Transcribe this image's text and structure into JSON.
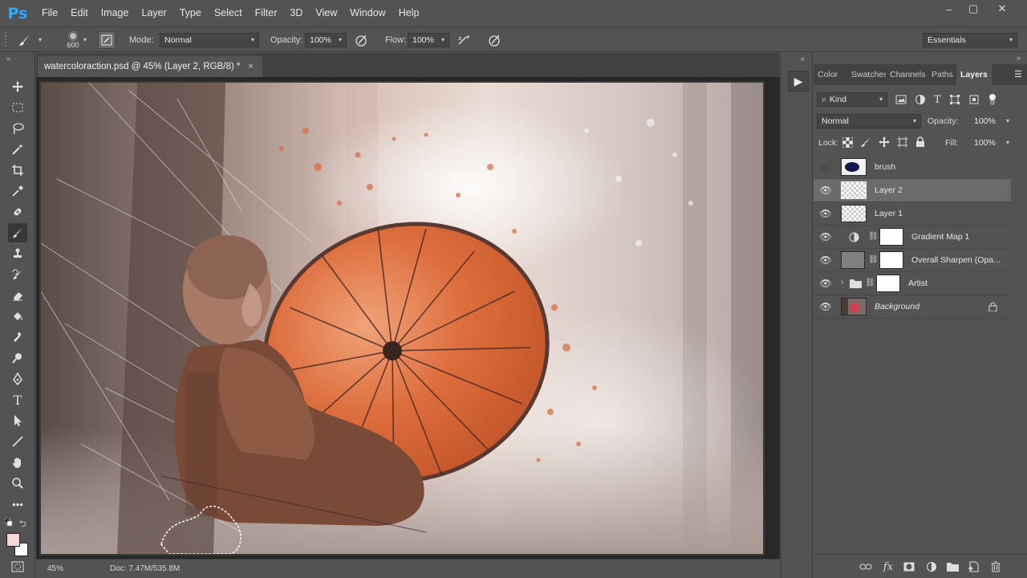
{
  "app": {
    "logo": "Ps",
    "menu": [
      "File",
      "Edit",
      "Image",
      "Layer",
      "Type",
      "Select",
      "Filter",
      "3D",
      "View",
      "Window",
      "Help"
    ],
    "window_controls": [
      "‒",
      "▢",
      "✕"
    ]
  },
  "options_bar": {
    "brush_size": "600",
    "mode_label": "Mode:",
    "mode_value": "Normal",
    "opacity_label": "Opacity:",
    "opacity_value": "100%",
    "flow_label": "Flow:",
    "flow_value": "100%",
    "workspace": "Essentials"
  },
  "document": {
    "tab_title": "watercoloraction.psd @ 45% (Layer 2, RGB/8) *",
    "close_glyph": "×",
    "zoom": "45%",
    "doc_info": "Doc: 7.47M/535.8M"
  },
  "panel": {
    "tabs": [
      "Color",
      "Swatches",
      "Channels",
      "Paths",
      "Layers"
    ],
    "active_tab": "Layers",
    "filter_kind": "Kind",
    "blend_mode": "Normal",
    "opacity_label": "Opacity:",
    "opacity_value": "100%",
    "lock_label": "Lock:",
    "fill_label": "Fill:",
    "fill_value": "100%",
    "layers": [
      {
        "name": "brush",
        "visible": false,
        "selected": false
      },
      {
        "name": "Layer 2",
        "visible": true,
        "selected": true
      },
      {
        "name": "Layer 1",
        "visible": true,
        "selected": false
      },
      {
        "name": "Gradient Map 1",
        "visible": true,
        "selected": false
      },
      {
        "name": "Overall Sharpen (Opa...",
        "visible": true,
        "selected": false
      },
      {
        "name": "Artist",
        "visible": true,
        "selected": false
      },
      {
        "name": "Background",
        "visible": true,
        "selected": false
      }
    ]
  },
  "colors": {
    "ui_bg": "#535353",
    "foreground_swatch": "#f6d6d6",
    "background_swatch": "#ffffff",
    "umbrella": "#d8693a",
    "ps_blue": "#31a8ff"
  }
}
